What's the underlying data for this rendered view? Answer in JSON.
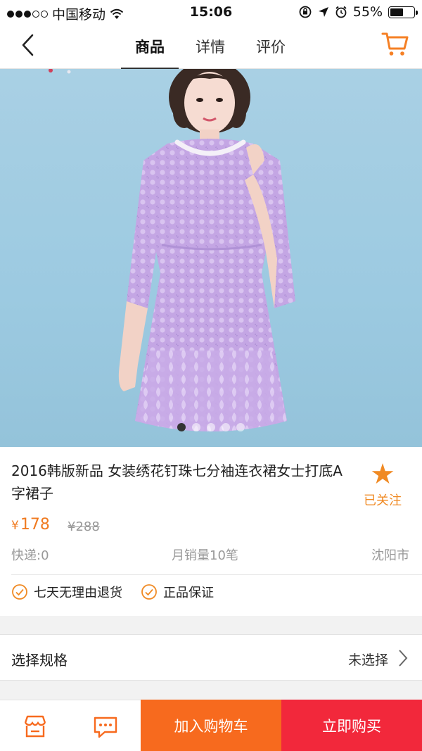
{
  "status_bar": {
    "carrier": "中国移动",
    "time": "15:06",
    "battery_percent": "55%",
    "battery_level": 0.55,
    "icons": [
      "signal-dots-icon",
      "wifi-icon",
      "rotation-lock-icon",
      "location-arrow-icon",
      "alarm-icon",
      "battery-icon"
    ]
  },
  "nav": {
    "back_icon": "chevron-left-icon",
    "tabs": [
      {
        "label": "商品",
        "active": true
      },
      {
        "label": "详情",
        "active": false
      },
      {
        "label": "评价",
        "active": false
      }
    ],
    "cart_icon": "shopping-cart-icon"
  },
  "gallery": {
    "slide_count": 5,
    "active_index": 0
  },
  "product": {
    "title": "2016韩版新品 女装绣花钉珠七分袖连衣裙女士打底A字裙子",
    "follow_label": "已关注",
    "follow_icon": "star-icon",
    "currency": "¥",
    "price": "178",
    "original_price": "¥288",
    "shipping": "快递:0",
    "monthly_sales": "月销量10笔",
    "city": "沈阳市",
    "guarantees": [
      "七天无理由退货",
      "正品保证"
    ]
  },
  "spec": {
    "label": "选择规格",
    "value": "未选择"
  },
  "bottom_bar": {
    "shop_icon": "store-icon",
    "chat_icon": "chat-bubble-icon",
    "add_to_cart": "加入购物车",
    "buy_now": "立即购买"
  },
  "colors": {
    "accent_orange": "#f76a1e",
    "buy_red": "#f2283b",
    "price_orange": "#f07a20",
    "hero_background": "#9ccae1",
    "dress_lavender": "#c8a9e6"
  }
}
